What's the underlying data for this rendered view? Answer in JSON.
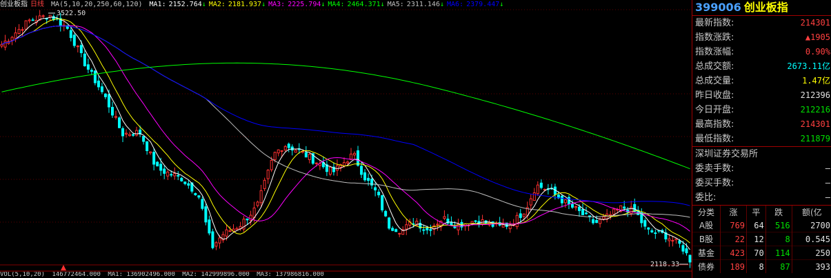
{
  "header": {
    "title": "创业板指",
    "period": "日线",
    "ma_params": "MA(5,10,20,250,60,120)",
    "ma": [
      {
        "label": "MA1:",
        "value": "2152.764",
        "arrow": "↓",
        "color": "#ffffff"
      },
      {
        "label": "MA2:",
        "value": "2181.937",
        "arrow": "↓",
        "color": "#ffff00"
      },
      {
        "label": "MA3:",
        "value": "2225.794",
        "arrow": "↓",
        "color": "#ff00ff"
      },
      {
        "label": "MA4:",
        "value": "2464.371",
        "arrow": "↓",
        "color": "#00ff00"
      },
      {
        "label": "MA5:",
        "value": "2311.146",
        "arrow": "↓",
        "color": "#c0c0c0"
      },
      {
        "label": "MA6:",
        "value": "2379.447",
        "arrow": "↓",
        "color": "#0000ff"
      }
    ]
  },
  "chart": {
    "high_label": "3522.50",
    "low_label": "2118.33",
    "colors": {
      "up": "#ff3030",
      "down": "#00ffff",
      "grid": "#800000"
    },
    "ma_colors": {
      "ma1": "#ffffff",
      "ma2": "#ffff00",
      "ma3": "#ff00ff",
      "ma4": "#00ff00",
      "ma5": "#c0c0c0",
      "ma6": "#0000ff"
    }
  },
  "volume_bar": {
    "label": "VOL(5,10,20)",
    "items": [
      "146772464.000",
      "MA1: 136902496.000",
      "MA2: 142999896.000",
      "MA3: 137986816.000"
    ]
  },
  "quote": {
    "code": "399006",
    "name": "创业板指",
    "rows": [
      {
        "label": "最新指数:",
        "value": "214301",
        "color": "red"
      },
      {
        "label": "指数涨跌:",
        "value": "▲1905",
        "color": "red"
      },
      {
        "label": "指数涨幅:",
        "value": "0.90%",
        "color": "red"
      },
      {
        "label": "总成交额:",
        "value": "2673.11亿",
        "color": "cyan"
      },
      {
        "label": "总成交量:",
        "value": "1.47亿",
        "color": "yellow"
      },
      {
        "label": "昨日收盘:",
        "value": "212396",
        "color": "white"
      },
      {
        "label": "今日开盘:",
        "value": "212216",
        "color": "green"
      },
      {
        "label": "最高指数:",
        "value": "214301",
        "color": "red"
      },
      {
        "label": "最低指数:",
        "value": "211879",
        "color": "green"
      }
    ],
    "exchange": "深圳证券交易所",
    "order_rows": [
      {
        "label": "委卖手数:",
        "value": "—"
      },
      {
        "label": "委买手数:",
        "value": "—"
      },
      {
        "label": "委比:",
        "value": "—"
      }
    ]
  },
  "stats": {
    "headers": [
      "分类",
      "涨",
      "平",
      "跌",
      "额(亿"
    ],
    "rows": [
      {
        "cat": "A股",
        "up": "769",
        "flat": "64",
        "down": "516",
        "amt": "2700"
      },
      {
        "cat": "B股",
        "up": "22",
        "flat": "12",
        "down": "8",
        "amt": "0.545"
      },
      {
        "cat": "基金",
        "up": "423",
        "flat": "70",
        "down": "114",
        "amt": "250"
      },
      {
        "cat": "债券",
        "up": "189",
        "flat": "8",
        "down": "87",
        "amt": "393"
      }
    ]
  }
}
